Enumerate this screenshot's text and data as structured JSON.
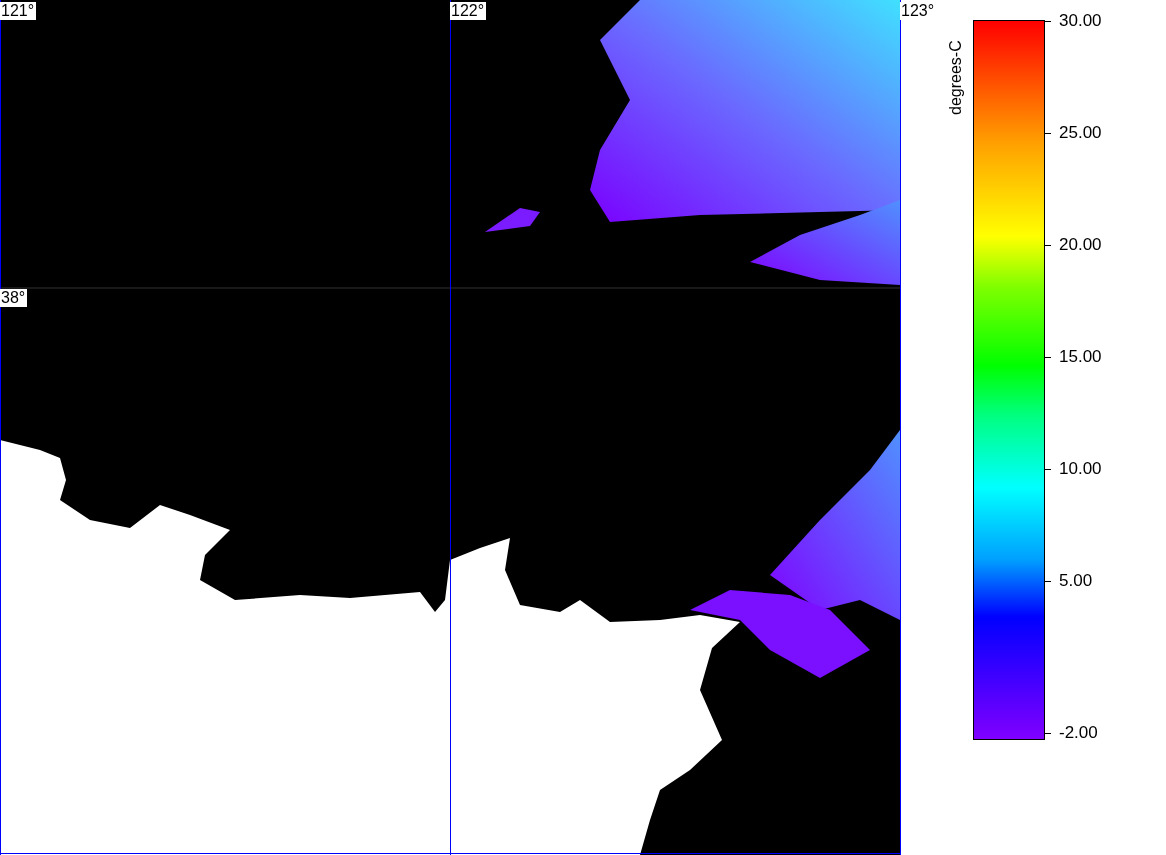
{
  "map": {
    "lon_labels": [
      "121°",
      "122°",
      "123°"
    ],
    "lat_labels": [
      "38°"
    ]
  },
  "colorbar": {
    "label": "degrees-C",
    "ticks": [
      "30.00",
      "25.00",
      "20.00",
      "15.00",
      "10.00",
      "5.00",
      "-2.00"
    ]
  }
}
